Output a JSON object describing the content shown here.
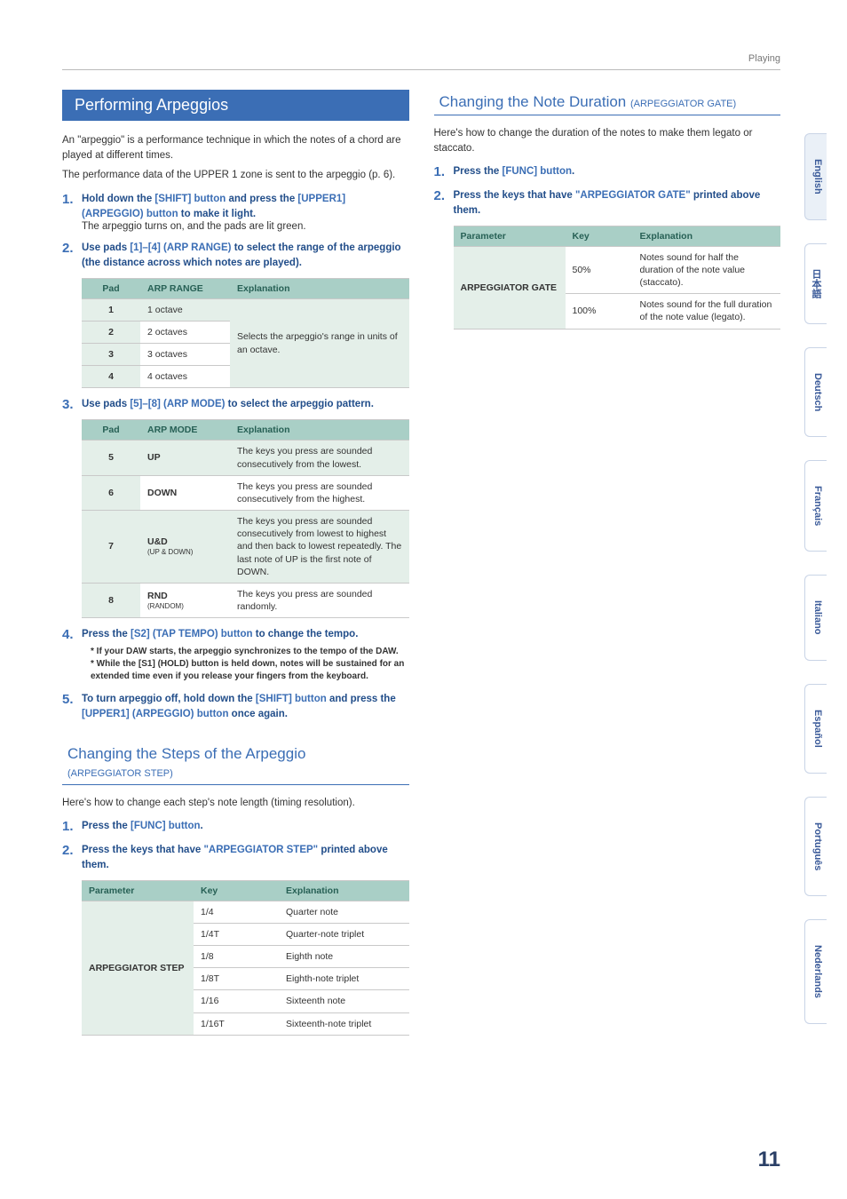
{
  "running_head": "Playing",
  "page_number": "11",
  "languages": [
    "English",
    "日本語",
    "Deutsch",
    "Français",
    "Italiano",
    "Español",
    "Português",
    "Nederlands"
  ],
  "arpeggio": {
    "title": "Performing Arpeggios",
    "intro1": "An \"arpeggio\" is a performance technique in which the notes of a chord are played at different times.",
    "intro2": "The performance data of the UPPER 1 zone is sent to the arpeggio (p. 6).",
    "step1": {
      "a": "Hold down the ",
      "b": "[SHIFT] button",
      "c": " and press the ",
      "d": "[UPPER1] (ARPEGGIO) button",
      "e": " to make it light."
    },
    "step1_sub": "The arpeggio turns on, and the pads are lit green.",
    "step2": {
      "a": "Use pads ",
      "b": "[1]–[4] (ARP RANGE)",
      "c": " to select the range of the arpeggio (the distance across which notes are played)."
    },
    "t_range": {
      "head": [
        "Pad",
        "ARP RANGE",
        "Explanation"
      ],
      "rows": [
        [
          "1",
          "1 octave"
        ],
        [
          "2",
          "2 octaves"
        ],
        [
          "3",
          "3 octaves"
        ],
        [
          "4",
          "4 octaves"
        ]
      ],
      "span": "Selects the arpeggio's range in units of an octave."
    },
    "step3": {
      "a": "Use pads ",
      "b": "[5]–[8] (ARP MODE)",
      "c": " to select the arpeggio pattern."
    },
    "t_mode": {
      "head": [
        "Pad",
        "ARP MODE",
        "Explanation"
      ],
      "rows": [
        [
          "5",
          "UP",
          "",
          "The keys you press are sounded consecutively from the lowest."
        ],
        [
          "6",
          "DOWN",
          "",
          "The keys you press are sounded consecutively from the highest."
        ],
        [
          "7",
          "U&D",
          "(UP & DOWN)",
          "The keys you press are sounded consecutively from lowest to highest and then back to lowest repeatedly. The last note of UP is the first note of DOWN."
        ],
        [
          "8",
          "RND",
          "(RANDOM)",
          "The keys you press are sounded randomly."
        ]
      ]
    },
    "step4": {
      "a": "Press the ",
      "b": "[S2] (TAP TEMPO) button",
      "c": " to change the tempo."
    },
    "note1": "If your DAW starts, the arpeggio synchronizes to the tempo of the DAW.",
    "note2": "While the [S1] (HOLD) button is held down, notes will be sustained for an extended time even if you release your fingers from the keyboard.",
    "step5": {
      "a": "To turn arpeggio off, hold down the ",
      "b": "[SHIFT] button",
      "c": " and press the ",
      "d": "[UPPER1] (ARPEGGIO) button",
      "e": " once again."
    }
  },
  "arp_step": {
    "title": "Changing the Steps of the Arpeggio ",
    "sub": "(ARPEGGIATOR STEP)",
    "intro": "Here's how to change each step's note length (timing resolution).",
    "step1": {
      "a": "Press the ",
      "b": "[FUNC] button",
      "c": "."
    },
    "step2": {
      "a": "Press the keys that have ",
      "b": "\"ARPEGGIATOR STEP\"",
      "c": " printed above them."
    },
    "table": {
      "head": [
        "Parameter",
        "Key",
        "Explanation"
      ],
      "param": "ARPEGGIATOR STEP",
      "rows": [
        [
          "1/4",
          "Quarter note"
        ],
        [
          "1/4T",
          "Quarter-note triplet"
        ],
        [
          "1/8",
          "Eighth note"
        ],
        [
          "1/8T",
          "Eighth-note triplet"
        ],
        [
          "1/16",
          "Sixteenth note"
        ],
        [
          "1/16T",
          "Sixteenth-note triplet"
        ]
      ]
    }
  },
  "arp_gate": {
    "title": "Changing the Note Duration ",
    "sub": "(ARPEGGIATOR GATE)",
    "intro": "Here's how to change the duration of the notes to make them legato or staccato.",
    "step1": {
      "a": "Press the ",
      "b": "[FUNC] button",
      "c": "."
    },
    "step2": {
      "a": "Press the keys that have ",
      "b": "\"ARPEGGIATOR GATE\"",
      "c": " printed above them."
    },
    "table": {
      "head": [
        "Parameter",
        "Key",
        "Explanation"
      ],
      "param": "ARPEGGIATOR GATE",
      "rows": [
        [
          "50%",
          "Notes sound for half the duration of the note value (staccato)."
        ],
        [
          "100%",
          "Notes sound for the full duration of the note value (legato)."
        ]
      ]
    }
  }
}
